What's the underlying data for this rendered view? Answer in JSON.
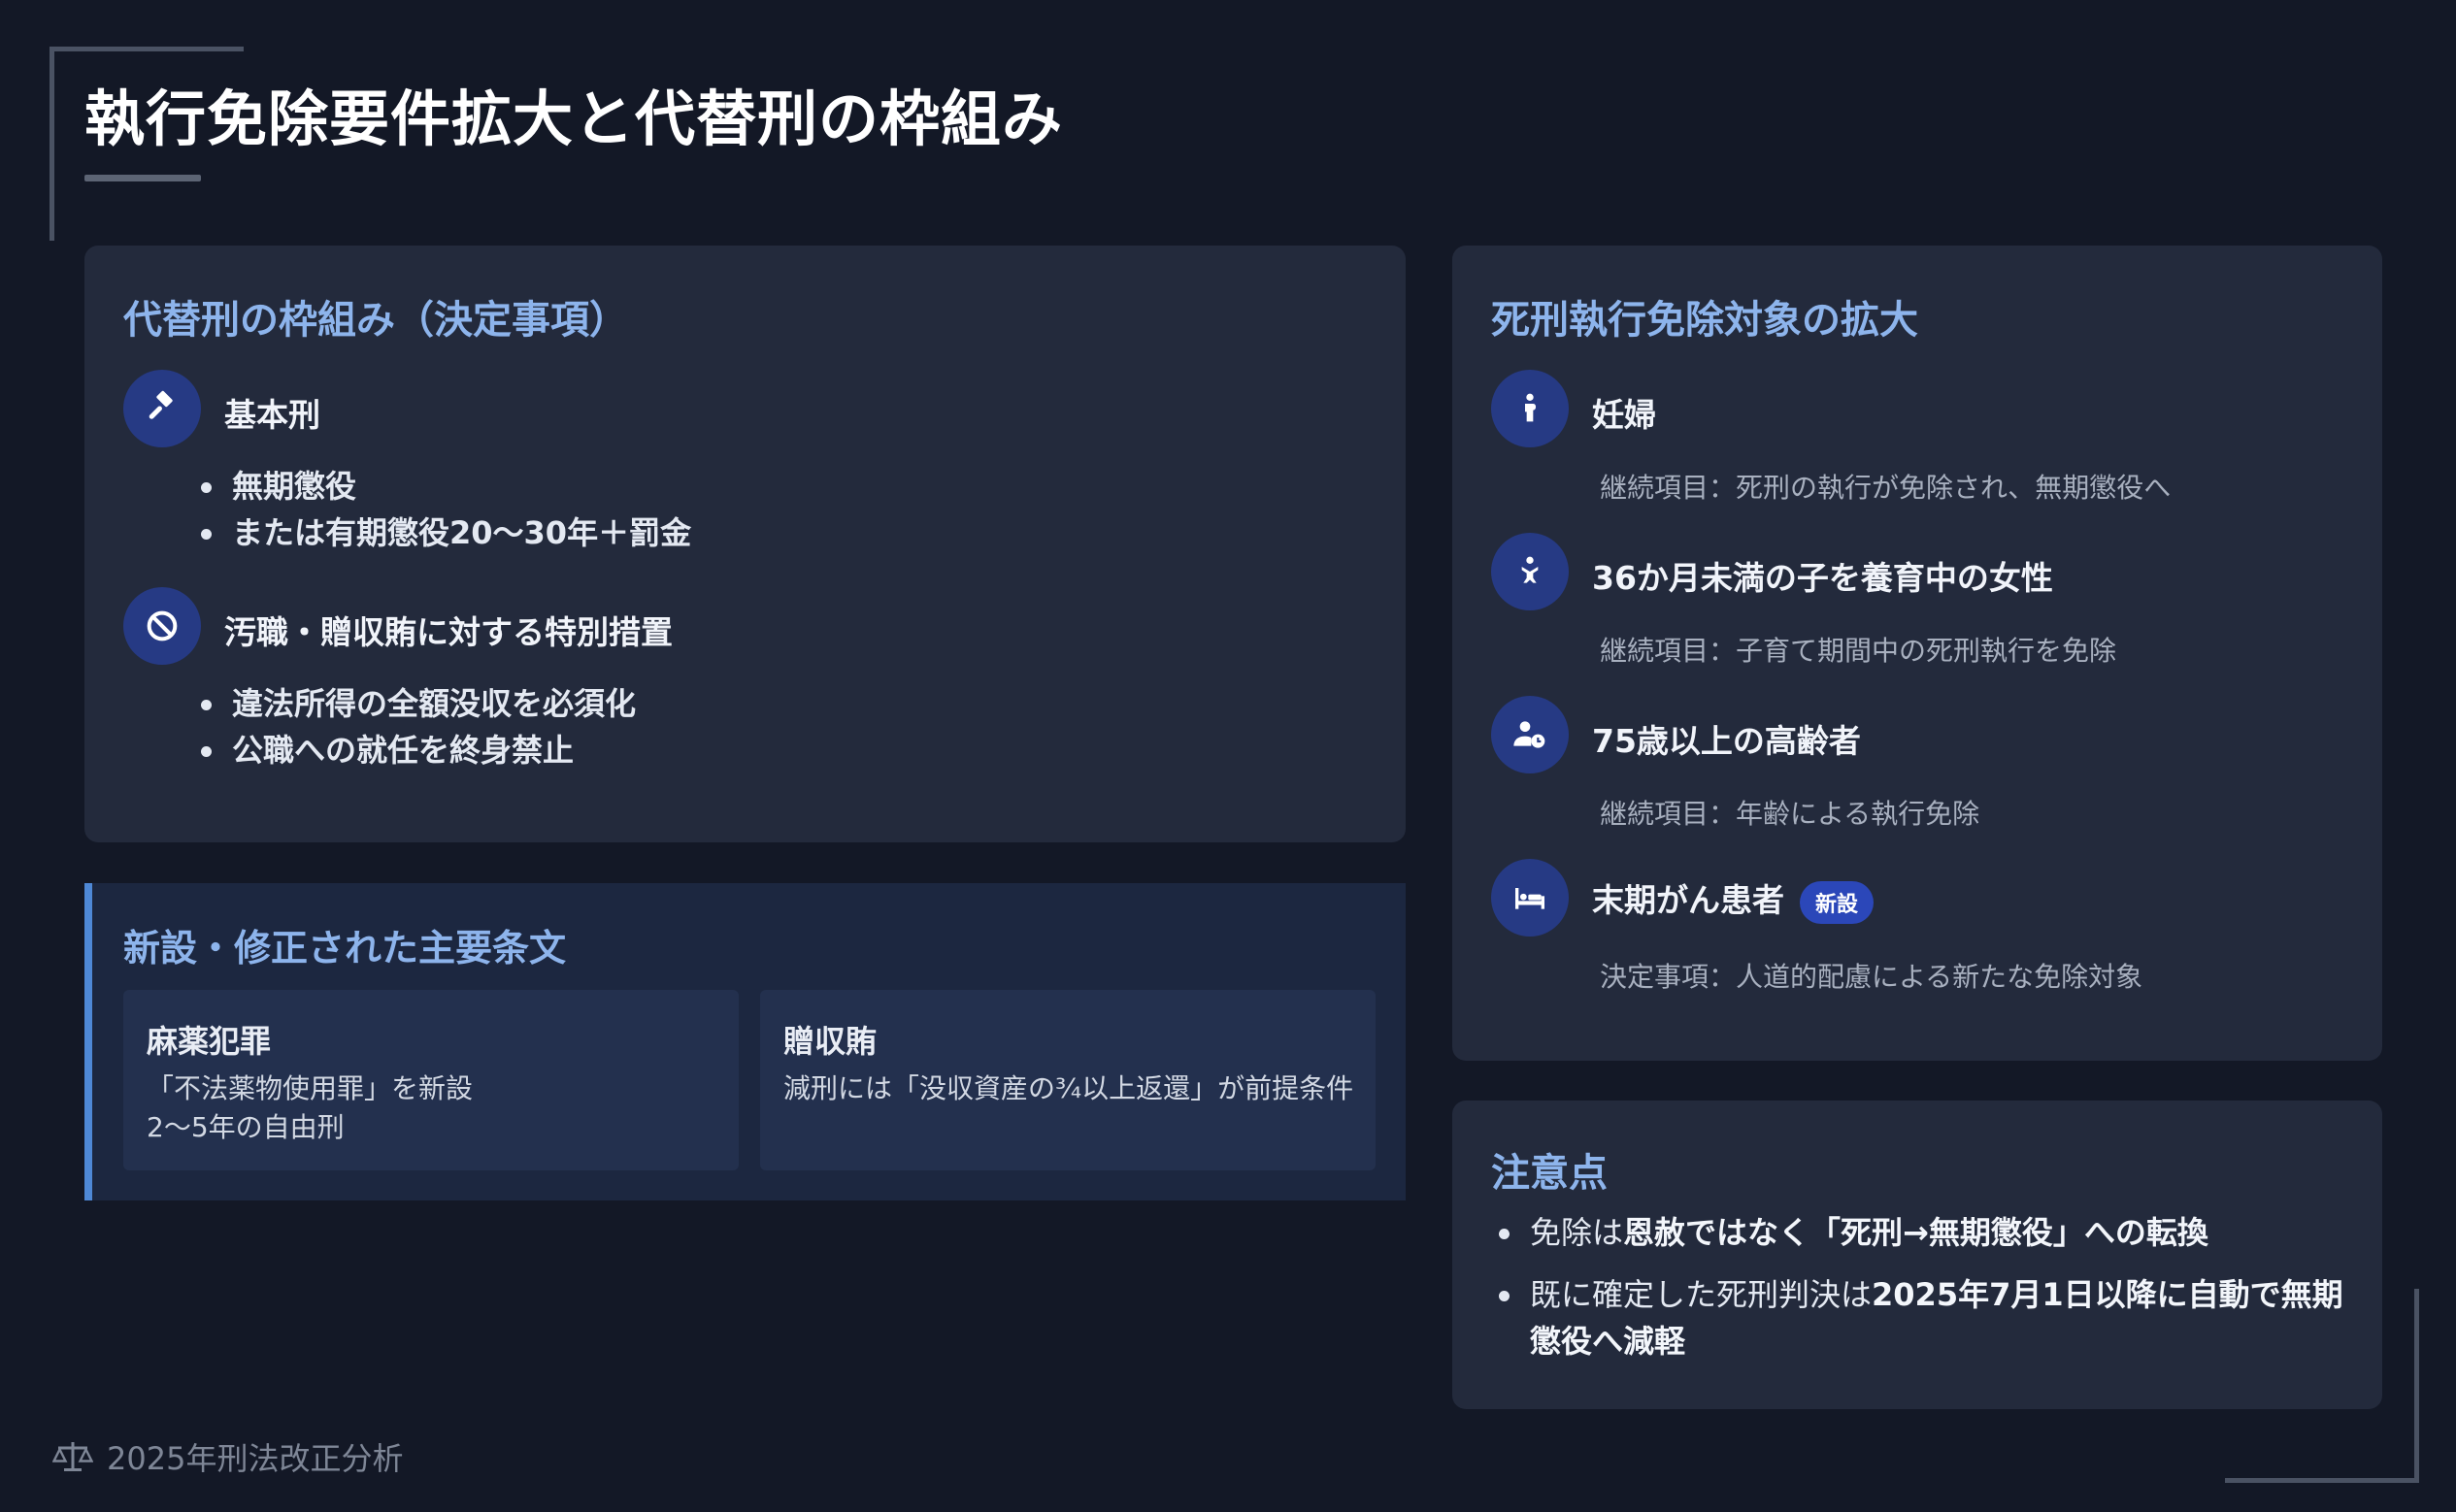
{
  "page": {
    "title": "執行免除要件拡大と代替刑の枠組み"
  },
  "alternative_penalty": {
    "title": "代替刑の枠組み（決定事項）",
    "items": [
      {
        "icon": "gavel-icon",
        "heading": "基本刑",
        "bullets": [
          "無期懲役",
          "または有期懲役20〜30年＋罰金"
        ]
      },
      {
        "icon": "prohibited-icon",
        "heading": "汚職・贈収賄に対する特別措置",
        "bullets": [
          "違法所得の全額没収を必須化",
          "公職への就任を終身禁止"
        ]
      }
    ]
  },
  "articles": {
    "title": "新設・修正された主要条文",
    "items": [
      {
        "title": "麻薬犯罪",
        "desc_lines": [
          "「不法薬物使用罪」を新設",
          "2〜5年の自由刑"
        ]
      },
      {
        "title": "贈収賄",
        "desc_lines": [
          "減刑には「没収資産の¾以上返還」が前提条件"
        ]
      }
    ]
  },
  "exemption": {
    "title": "死刑執行免除対象の拡大",
    "items": [
      {
        "icon": "pregnant-person-icon",
        "heading": "妊婦",
        "desc": "継続項目：死刑の執行が免除され、無期懲役へ"
      },
      {
        "icon": "baby-icon",
        "heading": "36か月未満の子を養育中の女性",
        "desc": "継続項目：子育て期間中の死刑執行を免除"
      },
      {
        "icon": "elderly-clock-icon",
        "heading": "75歳以上の高齢者",
        "desc": "継続項目：年齢による執行免除"
      },
      {
        "icon": "hospital-bed-icon",
        "heading": "末期がん患者",
        "badge": "新設",
        "desc": "決定事項：人道的配慮による新たな免除対象"
      }
    ]
  },
  "caution": {
    "title": "注意点",
    "item1": {
      "prefix": "免除は",
      "bold1": "恩赦ではなく「死刑→無期懲役」への転換"
    },
    "item2": {
      "prefix": "既に確定した死刑判決は",
      "bold1": "2025年7月1日以降に自動で無期懲役へ減軽"
    }
  },
  "footer": {
    "icon": "scales-icon",
    "text": "2025年刑法改正分析"
  },
  "colors": {
    "background": "#131826",
    "card": "#232a3c",
    "accent_title": "#8db4ec",
    "icon_circle": "#263a84",
    "badge": "#2b47b9",
    "panel_border": "#4e88d6"
  }
}
